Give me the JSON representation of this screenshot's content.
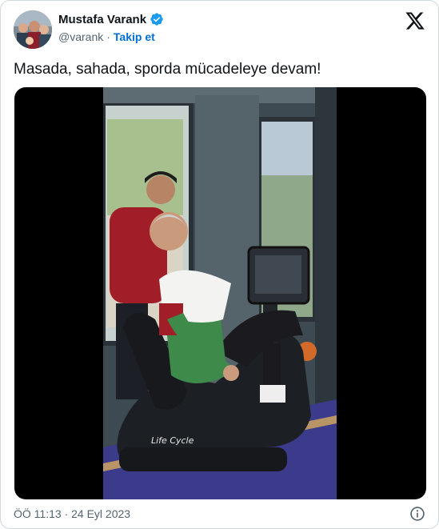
{
  "author": {
    "display_name": "Mustafa Varank",
    "handle": "@varank",
    "separator": "·",
    "follow_label": "Takip et"
  },
  "tweet": {
    "text": "Masada, sahada, sporda mücadeleye devam!"
  },
  "footer": {
    "timestamp": "ÖÖ 11:13 · 24 Eyl 2023"
  },
  "media": {
    "bike_brand": "Life Cycle"
  },
  "colors": {
    "follow_blue": "#006fd6",
    "verified_blue": "#1d9bf0",
    "muted_text": "#536471",
    "border": "#cfd9de"
  },
  "icons": {
    "verified": "verified-badge-icon",
    "brand": "x-logo-icon",
    "info": "info-icon"
  }
}
